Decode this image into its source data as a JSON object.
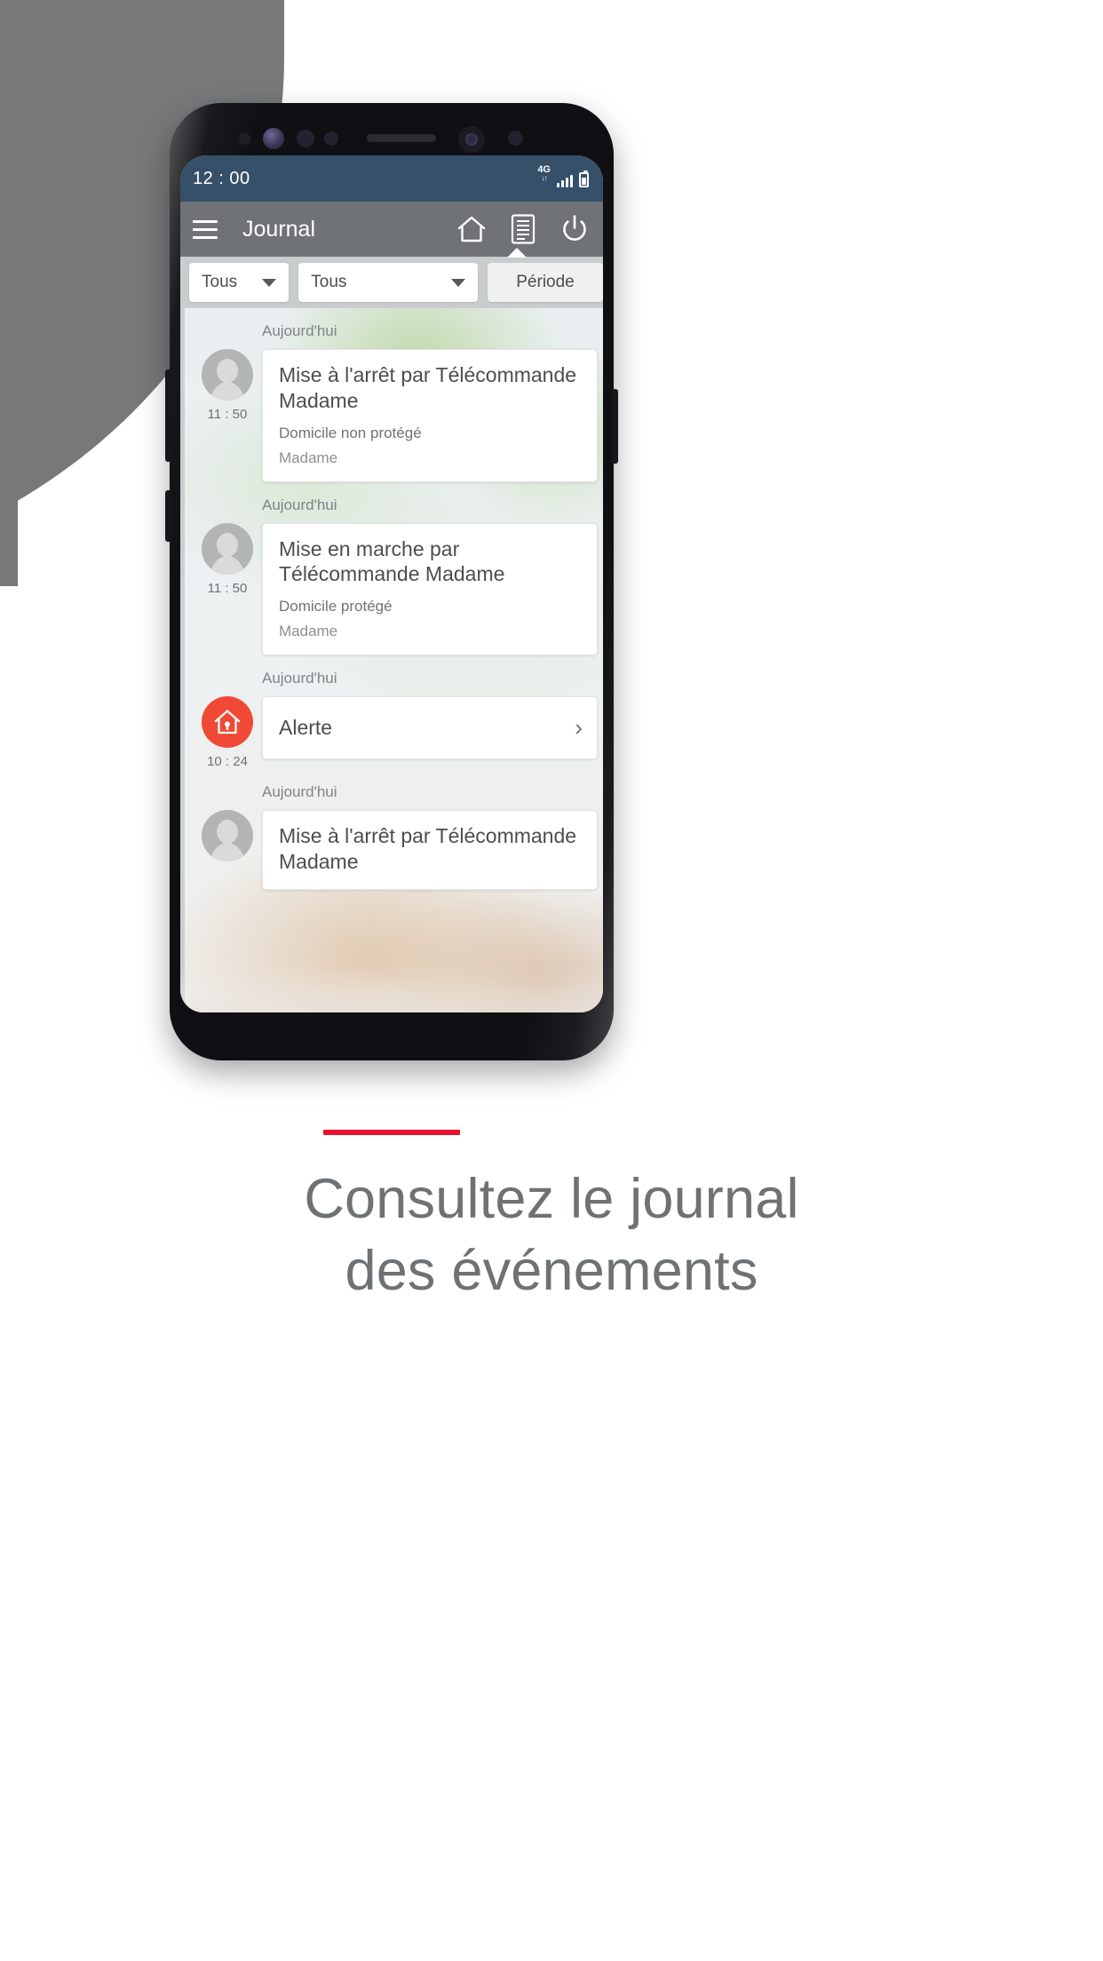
{
  "promo": {
    "caption_line1": "Consultez le journal",
    "caption_line2": "des événements",
    "accent_color": "#e8112d"
  },
  "phone": {
    "statusbar": {
      "time": "12 : 00",
      "network": "4G",
      "network_sub": "↓↑",
      "signal_icon": "signal-bars-icon",
      "battery_icon": "battery-icon",
      "bg_color": "#36506a"
    },
    "toolbar": {
      "menu_icon": "hamburger-menu-icon",
      "title": "Journal",
      "actions": [
        {
          "name": "home-icon",
          "label": "Accueil"
        },
        {
          "name": "journal-icon",
          "label": "Journal",
          "active": true
        },
        {
          "name": "power-icon",
          "label": "Marche/Arrêt"
        }
      ],
      "bg_color": "#6f7276"
    },
    "filters": {
      "type_filter": "Tous",
      "device_filter": "Tous",
      "period_button": "Période"
    },
    "events": [
      {
        "day": "Aujourd'hui",
        "time": "11 : 50",
        "icon": "user-avatar-icon",
        "title": "Mise à l'arrêt par Télécommande Madame",
        "subtitle": "Domicile non protégé",
        "detail": "Madame",
        "kind": "detail"
      },
      {
        "day": "Aujourd'hui",
        "time": "11 : 50",
        "icon": "user-avatar-icon",
        "title": "Mise en marche par Télécommande Madame",
        "subtitle": "Domicile protégé",
        "detail": "Madame",
        "kind": "detail"
      },
      {
        "day": "Aujourd'hui",
        "time": "10 : 24",
        "icon": "home-alert-icon",
        "title": "Alerte",
        "chevron": "›",
        "kind": "alert",
        "icon_color": "#f04a36"
      },
      {
        "day": "Aujourd'hui",
        "time": "",
        "icon": "user-avatar-icon",
        "title": "Mise à l'arrêt par Télécommande Madame",
        "subtitle": "",
        "detail": "",
        "kind": "detail"
      }
    ]
  }
}
